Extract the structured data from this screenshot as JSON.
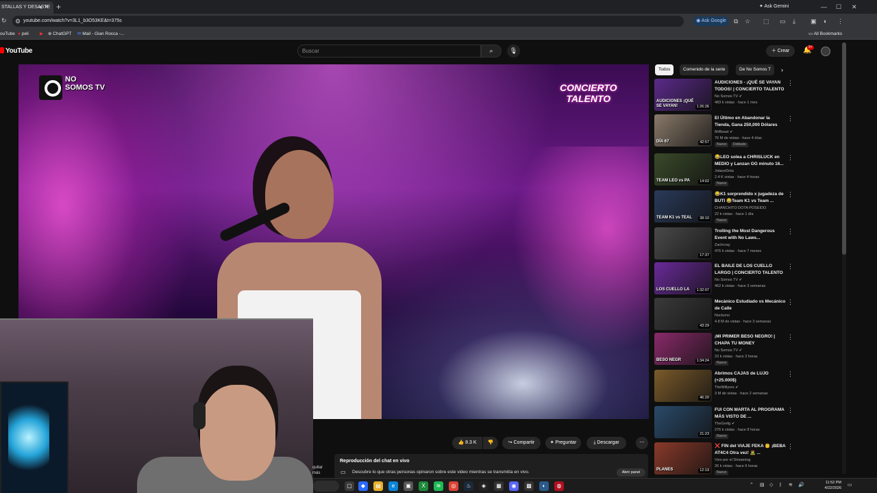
{
  "browser": {
    "tab_title": "STALLAS Y DESASTE",
    "new_tab": "+",
    "ask_gemini": "Ask Gemini",
    "url": "youtube.com/watch?v=3L1_b3O53KE&t=375s",
    "ask_google": "Ask Google",
    "all_bookmarks": "All Bookmarks",
    "bookmarks": [
      "ouTube",
      "peli",
      "ChatGPT",
      "Mail - Gian Rocca -..."
    ]
  },
  "youtube": {
    "logo": "YouTube",
    "search_placeholder": "Buscar",
    "create_label": "Crear",
    "notification_count": "9+"
  },
  "video": {
    "channel_logo_text": "NO SOMOS TV",
    "show_logo_line1": "CONCIERTO",
    "show_logo_line2": "TALENTO",
    "likes": "8.3 K",
    "actions": [
      "Compartir",
      "Preguntar",
      "Descargar"
    ]
  },
  "live_chat": {
    "title": "Reproducción del chat en vivo",
    "description": "Descubre lo que otras personas opinaron sobre este video mientras se transmitía en vivo.",
    "button": "Abrir panel"
  },
  "partial_text": "quitar\nmás",
  "sidebar": {
    "chips": [
      "Todos",
      "Comenido de la serie",
      "De No Somos T"
    ],
    "recommendations": [
      {
        "title": "AUDICIONES - ¡QUÉ SE VAYAN TODOS! | CONCIERTO TALENTO",
        "channel": "No Somos TV ✔",
        "meta": "483 k vistas · hace 1 mes",
        "duration": "1:26:26",
        "badge": "",
        "badge2": "",
        "color": "#5b2a8a"
      },
      {
        "title": "El Último en Abandonar la Tienda, Gana 250,000 Dólares",
        "channel": "MrBeast ✔",
        "meta": "76 M de vistas · hace 4 días",
        "duration": "42:57",
        "badge": "Nuevo",
        "badge2": "Doblado",
        "color": "#8a7a6a"
      },
      {
        "title": "😂LEO solea a CHRISLUCK en MEDIO y Lanzan GG minuto 16...",
        "channel": "JotaceDota",
        "meta": "2.4 K vistas · hace 4 horas",
        "duration": "14:02",
        "badge": "Nuevo",
        "badge2": "",
        "color": "#3a4a2a"
      },
      {
        "title": "😂K1 sorprendido x jugadeza de BUTI 😂Team K1 vs Team ...",
        "channel": "CHANCHITO DOTA POSEIDO",
        "meta": "22 k vistas · hace 1 día",
        "duration": "38:10",
        "badge": "Nuevo",
        "badge2": "",
        "color": "#2a3a5a"
      },
      {
        "title": "Trolling the Most Dangerous Event with No Laws...",
        "channel": "Zachcray",
        "meta": "476 k vistas · hace 7 meses",
        "duration": "17:37",
        "badge": "",
        "badge2": "",
        "color": "#4a4a4a"
      },
      {
        "title": "EL BAILE DE LOS CUELLO LARGO | CONCIERTO TALENTO",
        "channel": "No Somos TV ✔",
        "meta": "462 k vistas · hace 3 semanas",
        "duration": "1:32:07",
        "badge": "",
        "badge2": "",
        "color": "#6a2a9a"
      },
      {
        "title": "Mecánico Estudiado vs Mecánico de Calle",
        "channel": "Noctumo",
        "meta": "4.8 M de vistas · hace 3 semanas",
        "duration": "43:29",
        "badge": "",
        "badge2": "",
        "color": "#3a3a3a"
      },
      {
        "title": "¡MI PRIMER BESO NEGRO! | CHAPA TU MONEY",
        "channel": "No Somos TV ✔",
        "meta": "23 k vistas · hace 2 horas",
        "duration": "1:34:24",
        "badge": "Nuevo",
        "badge2": "",
        "color": "#8a2a6a"
      },
      {
        "title": "Abrimos CAJAS de LUJO (+25.000$)",
        "channel": "TheWillyrex ✔",
        "meta": "3 M de vistas · hace 2 semanas",
        "duration": "46:20",
        "badge": "",
        "badge2": "",
        "color": "#7a5a2a"
      },
      {
        "title": "FUI CON MARTA AL PROGRAMA MÁS VISTO DE ...",
        "channel": "TheGrefg ✔",
        "meta": "276 k vistas · hace 8 horas",
        "duration": "21:23",
        "badge": "Nuevo",
        "badge2": "",
        "color": "#2a4a6a"
      },
      {
        "title": "❌ FIN del VIAJE FEKA 👶 ¡BEBA AT4C4 Otra vez! 🧟 ...",
        "channel": "Vivo por el Streaming",
        "meta": "26 k vistas · hace 6 horas",
        "duration": "12:19",
        "badge": "Nuevo",
        "badge2": "",
        "color": "#8a3a2a"
      }
    ],
    "thumb_captions": [
      "AUDICIONES ¡QUÉ SE VAYAN!",
      "DÍA 67",
      "TEAM LEO vs PA",
      "TEAM K1 vs TEAL",
      "",
      "LOS CUELLO LA",
      "",
      "BESO NEGR",
      "",
      "",
      "PLANES"
    ]
  },
  "taskbar": {
    "time": "11:52 PM",
    "date": "4/22/2026"
  }
}
